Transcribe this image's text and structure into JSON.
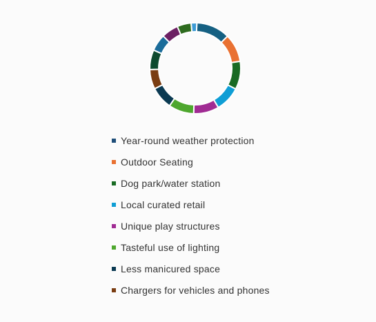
{
  "chart_data": {
    "type": "pie",
    "variant": "donut",
    "categories": [
      "Year-round weather protection",
      "Outdoor Seating",
      "Dog park/water station",
      "Local curated retail",
      "Unique play structures",
      "Tasteful use of lighting",
      "Less manicured space",
      "Chargers for vehicles and phones"
    ],
    "legend_colors": [
      "#1f4e79",
      "#e97132",
      "#196b24",
      "#0f9ed5",
      "#a02b93",
      "#4ea72e",
      "#0b3a52",
      "#7a3d12"
    ],
    "legend_placement": "bottom",
    "segments": [
      {
        "value": 12,
        "color": "#156082"
      },
      {
        "value": 10,
        "color": "#e97132"
      },
      {
        "value": 10,
        "color": "#196b24"
      },
      {
        "value": 9,
        "color": "#0f9ed5"
      },
      {
        "value": 9,
        "color": "#a02b93"
      },
      {
        "value": 9,
        "color": "#4ea72e"
      },
      {
        "value": 8,
        "color": "#0b3a52"
      },
      {
        "value": 7,
        "color": "#7a3d12"
      },
      {
        "value": 7,
        "color": "#0d4a2e"
      },
      {
        "value": 6,
        "color": "#1b6c9a"
      },
      {
        "value": 6,
        "color": "#6c2063"
      },
      {
        "value": 5,
        "color": "#2e6b1f"
      },
      {
        "value": 2,
        "color": "#3d9bd6"
      }
    ]
  }
}
